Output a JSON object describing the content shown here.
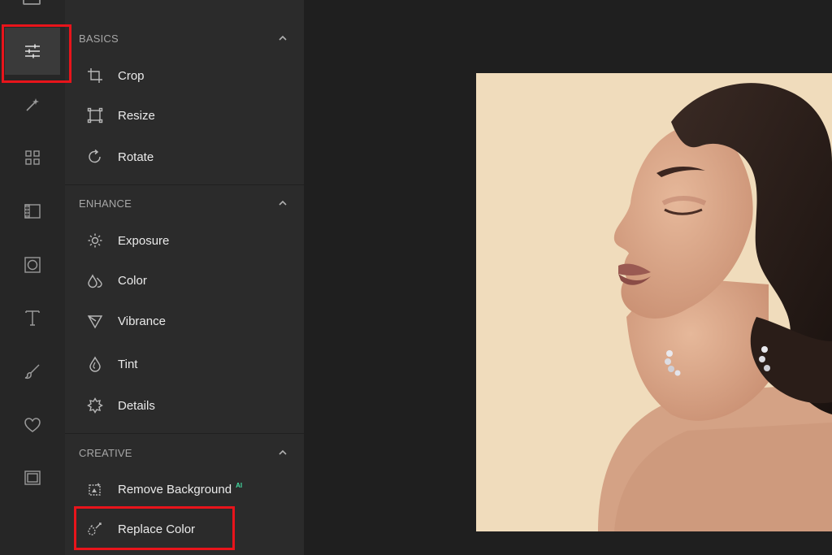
{
  "sections": [
    {
      "title": "BASICS",
      "tools": [
        {
          "label": "Crop",
          "icon": "crop-icon"
        },
        {
          "label": "Resize",
          "icon": "resize-icon"
        },
        {
          "label": "Rotate",
          "icon": "rotate-icon"
        }
      ]
    },
    {
      "title": "ENHANCE",
      "tools": [
        {
          "label": "Exposure",
          "icon": "exposure-icon"
        },
        {
          "label": "Color",
          "icon": "color-drop-icon"
        },
        {
          "label": "Vibrance",
          "icon": "vibrance-icon"
        },
        {
          "label": "Tint",
          "icon": "tint-drop-icon"
        },
        {
          "label": "Details",
          "icon": "details-icon"
        }
      ]
    },
    {
      "title": "CREATIVE",
      "tools": [
        {
          "label": "Remove Background",
          "icon": "remove-background-icon",
          "badge": "AI"
        },
        {
          "label": "Replace Color",
          "icon": "replace-color-icon"
        }
      ]
    }
  ],
  "rail_icons": [
    "adjustments-sliders-icon",
    "magic-wand-icon",
    "grid-icon",
    "film-frame-icon",
    "vignette-icon",
    "text-icon",
    "brush-icon",
    "heart-icon",
    "frame-icon"
  ],
  "colors": {
    "highlight": "#e8141b",
    "ai_badge": "#43d9a0",
    "photo_background": "#f0dcbc"
  }
}
